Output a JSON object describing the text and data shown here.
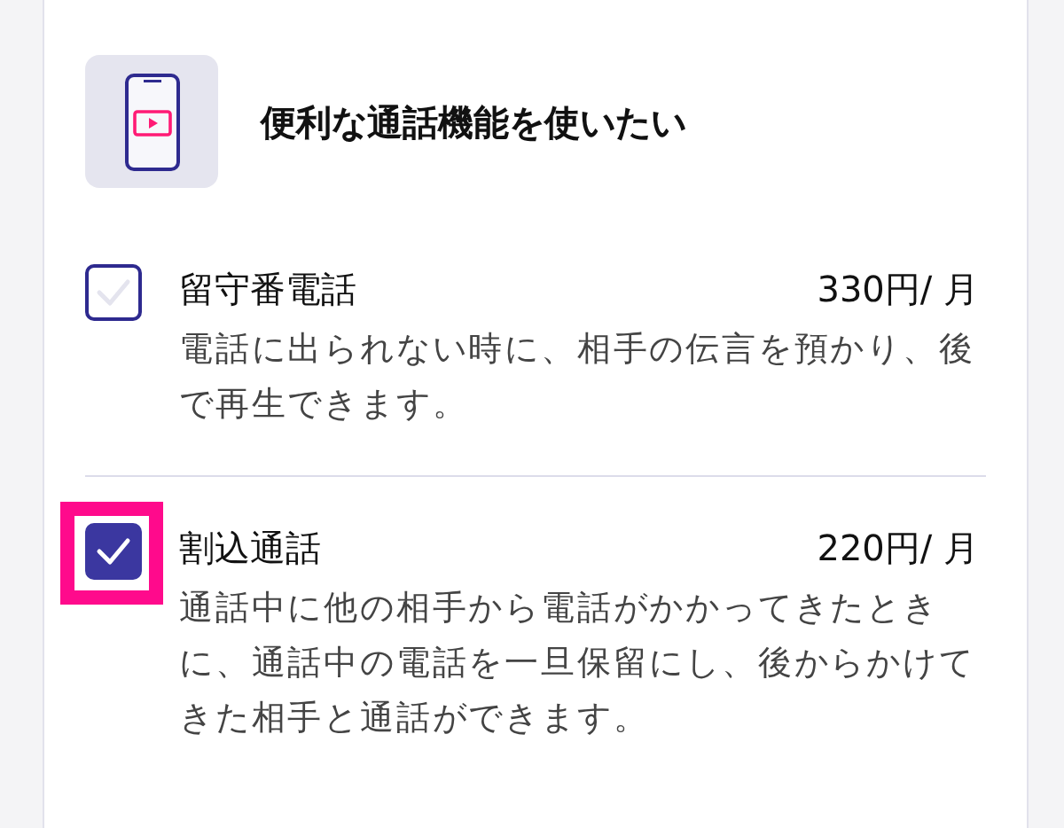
{
  "header": {
    "title": "便利な通話機能を使いたい"
  },
  "options": [
    {
      "name": "留守番電話",
      "price": "330円/ 月",
      "description": "電話に出られない時に、相手の伝言を預かり、後で再生できます。",
      "checked": false,
      "highlighted": false
    },
    {
      "name": "割込通話",
      "price": "220円/ 月",
      "description": "通話中に他の相手から電話がかかってきたときに、通話中の電話を一旦保留にし、後からかけてきた相手と通話ができます。",
      "checked": true,
      "highlighted": true
    }
  ]
}
